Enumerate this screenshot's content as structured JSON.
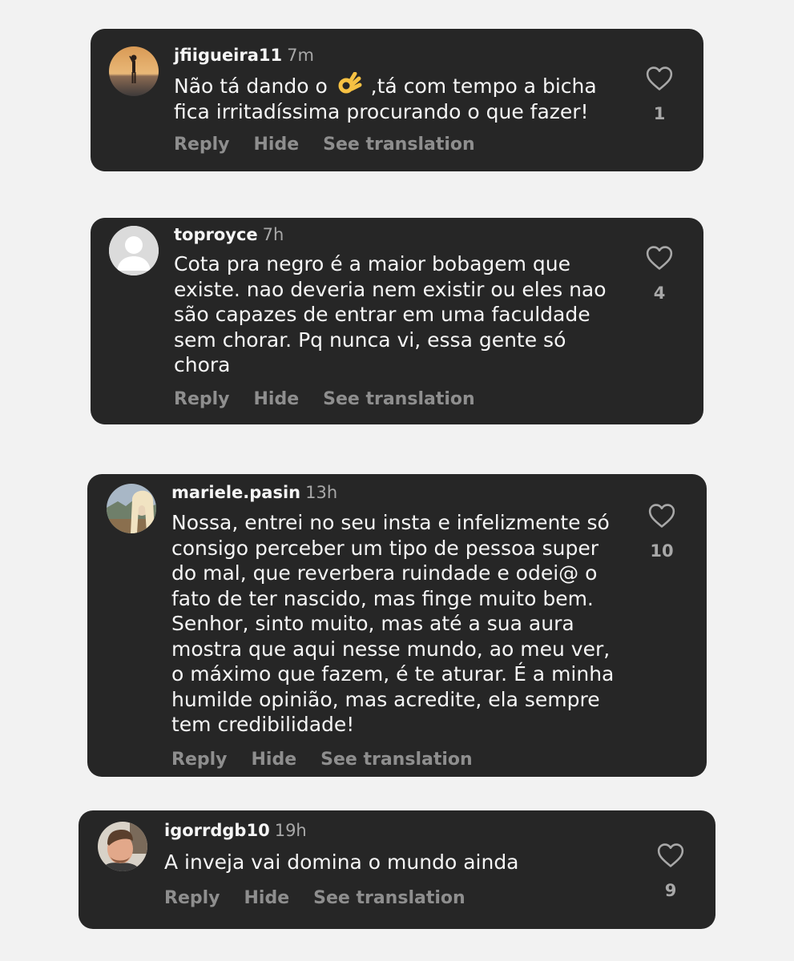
{
  "comments": [
    {
      "username": "jfiigueira11",
      "time": "7m",
      "text_before_emoji": "Não tá dando o ",
      "emoji": "ok-hand-emoji",
      "text_after_emoji": " ,tá com tempo a bicha\nfica irritadíssima procurando o que fazer!",
      "reply": "Reply",
      "hide": "Hide",
      "see_translation": "See translation",
      "likes": "1"
    },
    {
      "username": "toproyce",
      "time": "7h",
      "text": "Cota pra negro é a maior bobagem que\nexiste. nao deveria nem existir ou eles nao\nsão capazes de entrar em uma faculdade\nsem chorar. Pq nunca vi, essa gente só\nchora",
      "reply": "Reply",
      "hide": "Hide",
      "see_translation": "See translation",
      "likes": "4"
    },
    {
      "username": "mariele.pasin",
      "time": "13h",
      "text": "Nossa, entrei no seu insta e infelizmente só\nconsigo perceber um tipo de pessoa super\ndo mal, que reverbera ruindade e odei@ o\nfato de ter nascido, mas finge muito bem.\nSenhor, sinto muito, mas até a sua aura\nmostra que aqui nesse mundo, ao meu ver,\no máximo que fazem, é te aturar. É a minha\nhumilde opinião, mas acredite, ela sempre\ntem credibilidade!",
      "reply": "Reply",
      "hide": "Hide",
      "see_translation": "See translation",
      "likes": "10"
    },
    {
      "username": "igorrdgb10",
      "time": "19h",
      "text": "A inveja vai domina o mundo ainda",
      "reply": "Reply",
      "hide": "Hide",
      "see_translation": "See translation",
      "likes": "9"
    }
  ],
  "icons": {
    "like": "heart-outline-icon",
    "avatar_default": "default-user-icon"
  },
  "colors": {
    "page_background": "#f2f2f2",
    "card_background": "#262626",
    "text_primary": "#f5f5f5",
    "text_secondary": "#a8a8a8",
    "action_text": "#8e8e8e"
  }
}
